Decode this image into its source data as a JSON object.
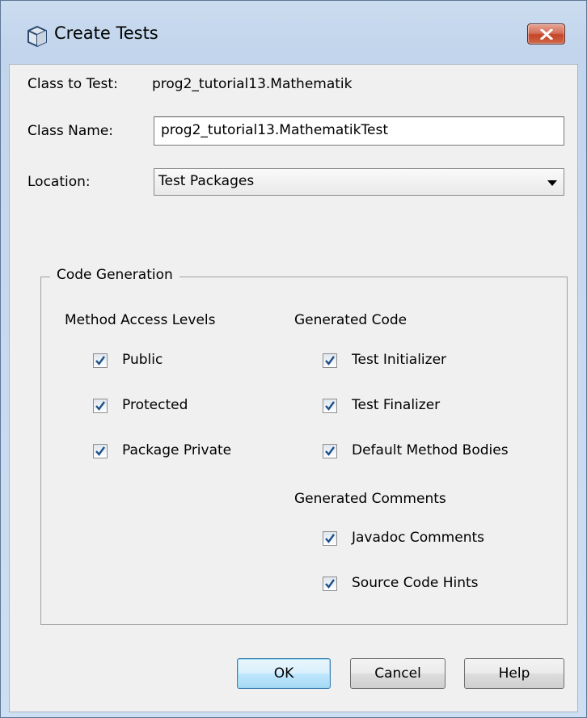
{
  "window": {
    "title": "Create Tests",
    "close_label": "×"
  },
  "form": {
    "class_to_test_label": "Class to Test:",
    "class_to_test_value": "prog2_tutorial13.Mathematik",
    "class_name_label": "Class Name:",
    "class_name_value": "prog2_tutorial13.MathematikTest",
    "location_label": "Location:",
    "location_value": "Test Packages"
  },
  "code_generation": {
    "legend": "Code Generation",
    "method_access_heading": "Method Access Levels",
    "method_access": [
      {
        "label": "Public",
        "checked": true
      },
      {
        "label": "Protected",
        "checked": true
      },
      {
        "label": "Package Private",
        "checked": true
      }
    ],
    "generated_code_heading": "Generated Code",
    "generated_code": [
      {
        "label": "Test Initializer",
        "checked": true
      },
      {
        "label": "Test Finalizer",
        "checked": true
      },
      {
        "label": "Default Method Bodies",
        "checked": true
      }
    ],
    "generated_comments_heading": "Generated Comments",
    "generated_comments": [
      {
        "label": "Javadoc Comments",
        "checked": true
      },
      {
        "label": "Source Code Hints",
        "checked": true
      }
    ]
  },
  "buttons": {
    "ok": "OK",
    "cancel": "Cancel",
    "help": "Help"
  },
  "colors": {
    "accent": "#3c7fb1",
    "close_red": "#c44426",
    "check_blue": "#1a4f8a"
  }
}
